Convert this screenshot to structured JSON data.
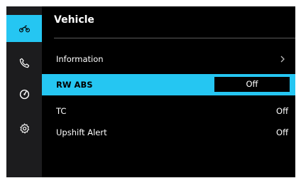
{
  "sidebar": {
    "items": [
      {
        "icon": "motorcycle-icon",
        "active": true
      },
      {
        "icon": "phone-icon",
        "active": false
      },
      {
        "icon": "gauge-icon",
        "active": false
      },
      {
        "icon": "gear-icon",
        "active": false
      }
    ]
  },
  "header": {
    "title": "Vehicle"
  },
  "menu": {
    "information": {
      "label": "Information",
      "icon": "chevron-right-icon"
    },
    "rw_abs": {
      "label": "RW ABS",
      "value": "Off"
    },
    "tc": {
      "label": "TC",
      "value": "Off"
    },
    "upshift_alert": {
      "label": "Upshift Alert",
      "value": "Off"
    }
  },
  "colors": {
    "accent": "#25c6f2",
    "sidebar_bg": "#1c1c1e",
    "screen_bg": "#000000",
    "text": "#ffffff"
  }
}
